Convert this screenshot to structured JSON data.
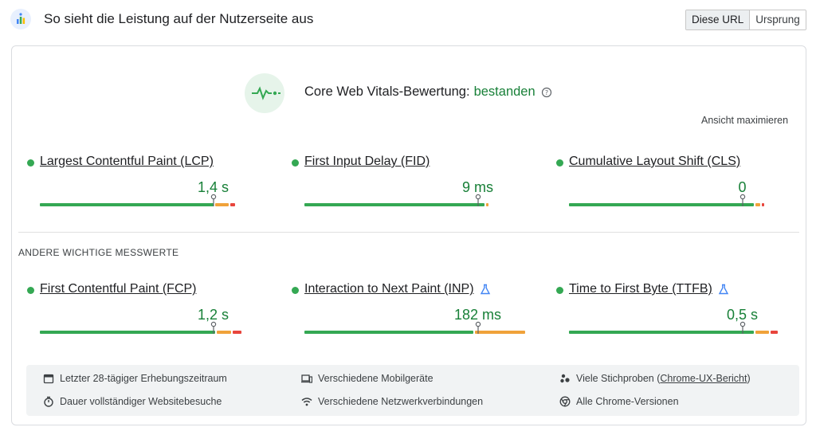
{
  "header": {
    "title": "So sieht die Leistung auf der Nutzerseite aus",
    "toggle": [
      "Diese URL",
      "Ursprung"
    ]
  },
  "assessment": {
    "label": "Core Web Vitals-Bewertung:",
    "status": "bestanden"
  },
  "maximize_label": "Ansicht maximieren",
  "core_metrics": [
    {
      "name": "Largest Contentful Paint (LCP)",
      "value": "1,4 s",
      "good_pct": 75,
      "ni_pct": 6,
      "poor_pct": 2,
      "marker_pct": 75,
      "experimental": false
    },
    {
      "name": "First Input Delay (FID)",
      "value": "9 ms",
      "good_pct": 78,
      "ni_pct": 1,
      "poor_pct": 0,
      "marker_pct": 75,
      "experimental": false
    },
    {
      "name": "Cumulative Layout Shift (CLS)",
      "value": "0",
      "good_pct": 80,
      "ni_pct": 2,
      "poor_pct": 1,
      "marker_pct": 75,
      "experimental": false
    }
  ],
  "section_label": "ANDERE WICHTIGE MESSWERTE",
  "other_metrics": [
    {
      "name": "First Contentful Paint (FCP)",
      "value": "1,2 s",
      "good_pct": 76,
      "ni_pct": 6,
      "poor_pct": 4,
      "marker_pct": 75,
      "experimental": false
    },
    {
      "name": "Interaction to Next Paint (INP)",
      "value": "182 ms",
      "good_pct": 73,
      "ni_pct": 22,
      "poor_pct": 0,
      "marker_pct": 75,
      "experimental": true
    },
    {
      "name": "Time to First Byte (TTFB)",
      "value": "0,5 s",
      "good_pct": 80,
      "ni_pct": 6,
      "poor_pct": 3,
      "marker_pct": 75,
      "experimental": true
    }
  ],
  "footer": {
    "items": [
      {
        "text": "Letzter 28-tägiger Erhebungszeitraum",
        "icon": "calendar-icon"
      },
      {
        "text": "Verschiedene Mobilgeräte",
        "icon": "devices-icon"
      },
      {
        "text": "Viele Stichproben (",
        "link": "Chrome-UX-Bericht",
        "suffix": ")",
        "icon": "samples-icon"
      },
      {
        "text": "Dauer vollständiger Websitebesuche",
        "icon": "timer-icon"
      },
      {
        "text": "Verschiedene Netzwerkverbindungen",
        "icon": "wifi-icon"
      },
      {
        "text": "Alle Chrome-Versionen",
        "icon": "chrome-icon"
      }
    ]
  },
  "colors": {
    "good": "#34a853",
    "needs_improvement": "#f0a23a",
    "poor": "#e8453c",
    "status_text": "#188038"
  }
}
